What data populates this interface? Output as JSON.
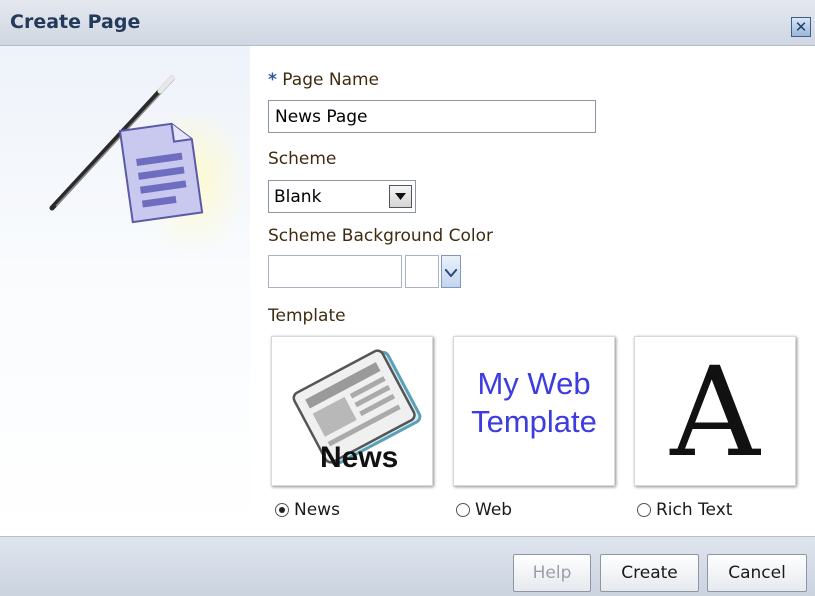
{
  "dialog": {
    "title": "Create Page",
    "close_icon": "close-icon"
  },
  "form": {
    "required_mark": "*",
    "page_name_label": "Page Name",
    "page_name_value": "News Page",
    "scheme_label": "Scheme",
    "scheme_value": "Blank",
    "scheme_bg_label": "Scheme Background Color",
    "scheme_bg_value": "",
    "template_label": "Template"
  },
  "templates": [
    {
      "label": "News",
      "selected": true,
      "tile_text": "News"
    },
    {
      "label": "Web",
      "selected": false,
      "tile_text": "My Web Template"
    },
    {
      "label": "Rich Text",
      "selected": false,
      "tile_text": "A"
    }
  ],
  "web_tile": {
    "line1": "My Web",
    "line2": "Template"
  },
  "buttons": {
    "help": "Help",
    "create": "Create",
    "cancel": "Cancel"
  },
  "colors": {
    "label_text": "#3f2c10",
    "required": "#2f57a4",
    "web_template_text": "#3c3ce0",
    "title_bar": "#d0d7e2"
  }
}
